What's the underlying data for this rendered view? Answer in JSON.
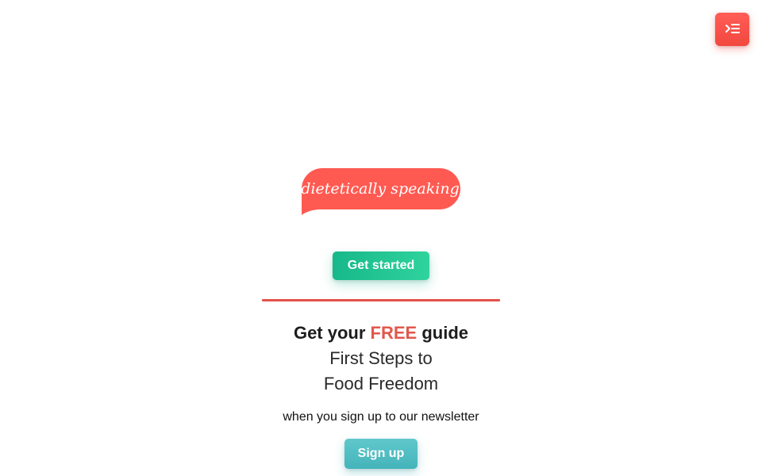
{
  "header": {
    "menu_icon": "menu-toggle-icon",
    "accent_color": "#f2473f"
  },
  "logo": {
    "text": "dietetically speaking",
    "bubble_color": "#ff5a52"
  },
  "hero": {
    "get_started_label": "Get started",
    "get_started_color": "#1fc090"
  },
  "promo": {
    "heading_prefix": "Get your",
    "heading_highlight": "FREE",
    "heading_suffix": "guide",
    "title_line1": "First Steps to",
    "title_line2": "Food Freedom",
    "newsletter_text": "when you sign up to our newsletter",
    "signup_label": "Sign up",
    "highlight_color": "#e2574c",
    "signup_color": "#4fbdc2"
  }
}
